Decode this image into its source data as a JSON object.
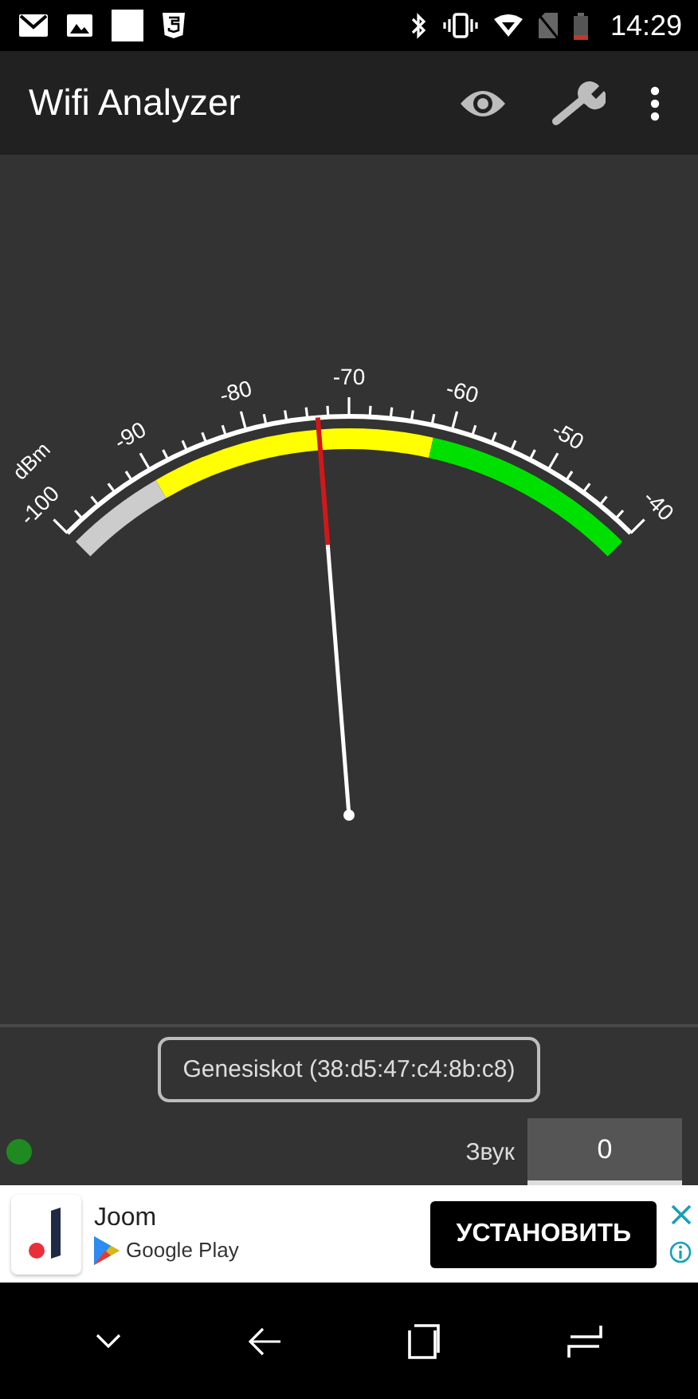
{
  "status_bar": {
    "time": "14:29"
  },
  "app_bar": {
    "title": "Wifi Analyzer"
  },
  "gauge": {
    "unit": "dBm",
    "ticks": [
      "-100",
      "-90",
      "-80",
      "-70",
      "-60",
      "-50",
      "-40"
    ],
    "bands": [
      {
        "color": "#cccccc"
      },
      {
        "color": "#ffff00"
      },
      {
        "color": "#00e000"
      }
    ]
  },
  "network": {
    "label": "Genesiskot (38:d5:47:c4:8b:c8)"
  },
  "status_dot": {
    "color": "#1f8a1f"
  },
  "sound": {
    "label": "Звук",
    "value": "0"
  },
  "ad": {
    "app_name": "Joom",
    "store": "Google Play",
    "button": "УСТАНОВИТЬ"
  }
}
